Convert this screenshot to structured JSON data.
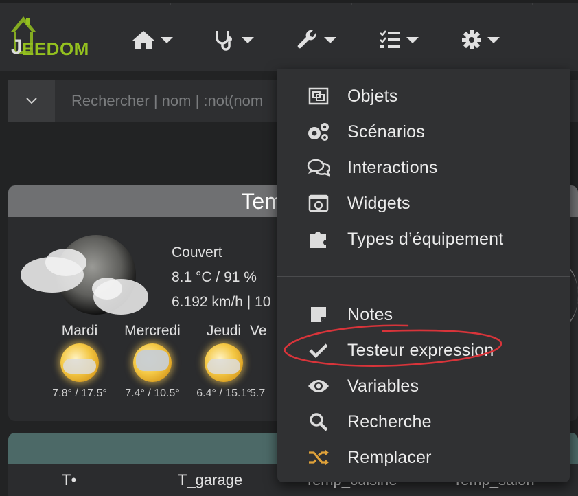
{
  "brand": {
    "logo_text": "EEDOM",
    "logo_color": "#94c11f"
  },
  "nav": {
    "items": [
      {
        "icon": "home-icon"
      },
      {
        "icon": "stethoscope-icon"
      },
      {
        "icon": "wrench-icon"
      },
      {
        "icon": "tasks-icon"
      },
      {
        "icon": "gear-icon"
      }
    ]
  },
  "search": {
    "placeholder": "Rechercher | nom | :not(nom"
  },
  "weather_card": {
    "title": "Temperatu",
    "condition": "Couvert",
    "temp_humidity": "8.1 °C / 91 %",
    "wind": "6.192 km/h | 10",
    "forecast": [
      {
        "day": "Mardi",
        "temps": "7.8° / 17.5°"
      },
      {
        "day": "Mercredi",
        "temps": "7.4° / 10.5°"
      },
      {
        "day": "Jeudi",
        "temps": "6.4° / 15.1°"
      },
      {
        "day": "Ve",
        "temps": "5.7"
      }
    ]
  },
  "second_card": {
    "labels": [
      "T•",
      "T_garage",
      "Temp_cuisine",
      "Temp_salon"
    ]
  },
  "dropdown": {
    "items": [
      {
        "label": "Objets",
        "icon": "object-group-icon"
      },
      {
        "label": "Scénarios",
        "icon": "cogs-icon"
      },
      {
        "label": "Interactions",
        "icon": "comments-icon"
      },
      {
        "label": "Widgets",
        "icon": "widget-icon"
      },
      {
        "label": "Types d’équipement",
        "icon": "puzzle-icon"
      }
    ],
    "items2": [
      {
        "label": "Notes",
        "icon": "sticky-note-icon"
      },
      {
        "label": "Testeur expression",
        "icon": "check-icon"
      },
      {
        "label": "Variables",
        "icon": "eye-icon"
      },
      {
        "label": "Recherche",
        "icon": "search-icon"
      },
      {
        "label": "Remplacer",
        "icon": "random-icon",
        "icon_color": "#e0a23a"
      }
    ],
    "annotation_color": "#d8343a"
  }
}
